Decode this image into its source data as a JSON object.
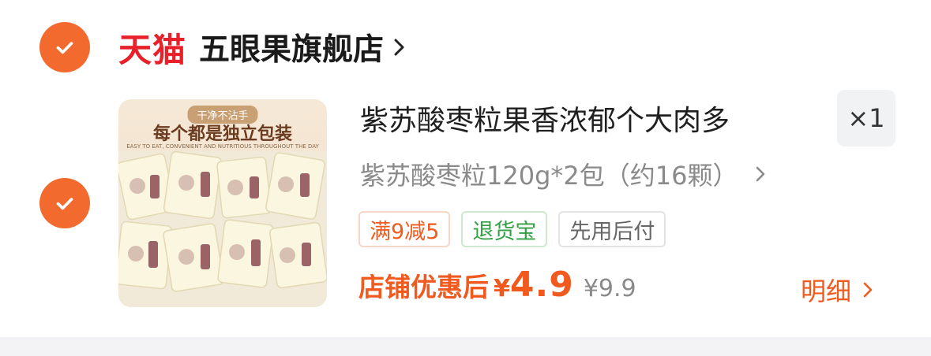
{
  "store": {
    "platform_logo_text": "天猫",
    "name": "五眼果旗舰店"
  },
  "product": {
    "image_tag": "干净不沾手",
    "image_slogan": "每个都是独立包装",
    "image_small_text": "EASY TO EAT, CONVENIENT AND NUTRITIOUS THROUGHOUT THE DAY",
    "title": "紫苏酸枣粒果香浓郁个大肉多",
    "quantity": "×1",
    "spec": "紫苏酸枣粒120g*2包（约16颗）",
    "tags": [
      "满9减5",
      "退货宝",
      "先用后付"
    ],
    "price_label": "店铺优惠后",
    "currency": "¥",
    "price": "4.9",
    "original_price": "¥9.9",
    "detail_label": "明细"
  },
  "colors": {
    "accent": "#f05a1f",
    "check": "#f26a2e",
    "tmall_red": "#e8202a",
    "green": "#33a045"
  }
}
